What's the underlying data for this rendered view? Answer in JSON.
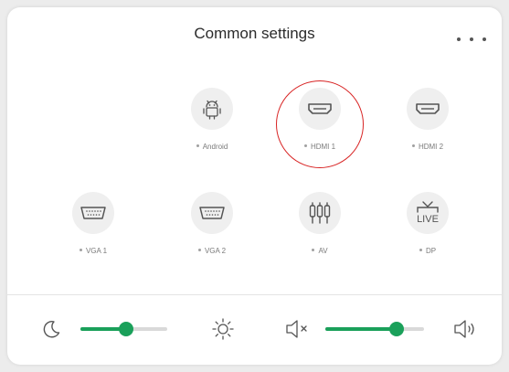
{
  "panel": {
    "title": "Common settings",
    "more_icon": "more-horizontal-icon"
  },
  "sources": [
    {
      "label": "Android",
      "icon": "android-icon",
      "selected": false
    },
    {
      "label": "HDMI 1",
      "icon": "hdmi-port-icon",
      "selected": true
    },
    {
      "label": "HDMI 2",
      "icon": "hdmi-port-icon",
      "selected": false
    },
    {
      "label": "VGA 1",
      "icon": "vga-port-icon",
      "selected": false
    },
    {
      "label": "VGA 2",
      "icon": "vga-port-icon",
      "selected": false
    },
    {
      "label": "AV",
      "icon": "av-rca-icon",
      "selected": false
    },
    {
      "label": "DP",
      "icon": "live-tv-icon",
      "icon_text": "LIVE",
      "selected": false
    }
  ],
  "brightness": {
    "min_icon": "moon-icon",
    "max_icon": "sun-icon",
    "level": 0.53
  },
  "volume": {
    "min_icon": "speaker-mute-icon",
    "max_icon": "speaker-loud-icon",
    "level": 0.72
  },
  "colors": {
    "accent": "#1aa05a",
    "selection_ring": "#d82424",
    "icon_bg": "#efefef"
  }
}
